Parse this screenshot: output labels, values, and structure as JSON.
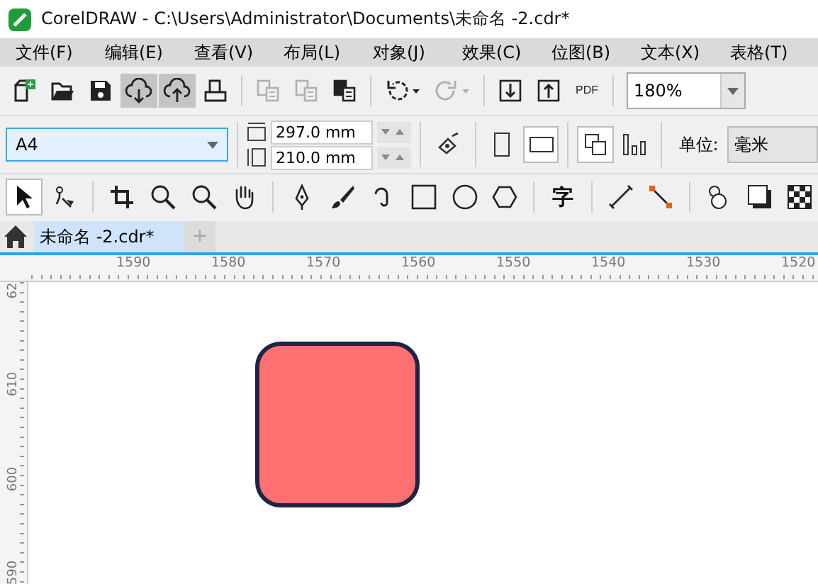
{
  "window": {
    "title": "CorelDRAW - C:\\Users\\Administrator\\Documents\\未命名 -2.cdr*"
  },
  "menu": [
    "文件(F)",
    "编辑(E)",
    "查看(V)",
    "布局(L)",
    "对象(J)",
    "效果(C)",
    "位图(B)",
    "文本(X)",
    "表格(T)"
  ],
  "standard_toolbar": [
    {
      "kind": "new",
      "pressed": false,
      "disabled": false
    },
    {
      "kind": "open",
      "pressed": false,
      "disabled": false
    },
    {
      "kind": "save",
      "pressed": false,
      "disabled": false
    },
    {
      "kind": "cloud-down",
      "pressed": true,
      "disabled": false
    },
    {
      "kind": "cloud-up",
      "pressed": true,
      "disabled": false
    },
    {
      "kind": "print",
      "pressed": false,
      "disabled": false
    },
    {
      "kind": "cut",
      "pressed": false,
      "disabled": true
    },
    {
      "kind": "copy",
      "pressed": false,
      "disabled": true
    },
    {
      "kind": "paste",
      "pressed": false,
      "disabled": false
    },
    {
      "kind": "undo",
      "pressed": false,
      "disabled": false
    },
    {
      "kind": "redo",
      "pressed": false,
      "disabled": true
    },
    {
      "kind": "import",
      "pressed": false,
      "disabled": false
    },
    {
      "kind": "export",
      "pressed": false,
      "disabled": false
    },
    {
      "kind": "pdf",
      "pressed": false,
      "disabled": false
    }
  ],
  "pdf_label": "PDF",
  "zoom": {
    "value": "180%"
  },
  "property_bar": {
    "page_size": "A4",
    "width": "297.0 mm",
    "height": "210.0 mm",
    "portrait_selected": false,
    "landscape_selected": true,
    "unit_label": "单位:",
    "unit_value": "毫米"
  },
  "toolbox": [
    {
      "kind": "pick",
      "selected": true
    },
    {
      "kind": "shape",
      "selected": false
    },
    {
      "kind": "crop",
      "selected": false
    },
    {
      "kind": "zoom",
      "selected": false
    },
    {
      "kind": "zoom-out",
      "selected": false
    },
    {
      "kind": "pan",
      "selected": false
    },
    {
      "kind": "pen",
      "selected": false
    },
    {
      "kind": "brush",
      "selected": false
    },
    {
      "kind": "curve",
      "selected": false
    },
    {
      "kind": "rect",
      "selected": false
    },
    {
      "kind": "ellipse",
      "selected": false
    },
    {
      "kind": "polygon",
      "selected": false
    },
    {
      "kind": "text",
      "selected": false
    },
    {
      "kind": "line",
      "selected": false
    },
    {
      "kind": "connector",
      "selected": false
    },
    {
      "kind": "blend",
      "selected": false
    },
    {
      "kind": "shadow",
      "selected": false
    },
    {
      "kind": "transparency",
      "selected": false
    }
  ],
  "text_tool_glyph": "字",
  "tabs": [
    {
      "label": "未命名 -2.cdr*",
      "selected": true
    }
  ],
  "add_tab": "+",
  "horizontal_ruler": [
    "1590",
    "1580",
    "1570",
    "1560",
    "1550",
    "1540",
    "1530",
    "1520"
  ],
  "vertical_ruler": [
    "62",
    "610",
    "600",
    "590"
  ]
}
